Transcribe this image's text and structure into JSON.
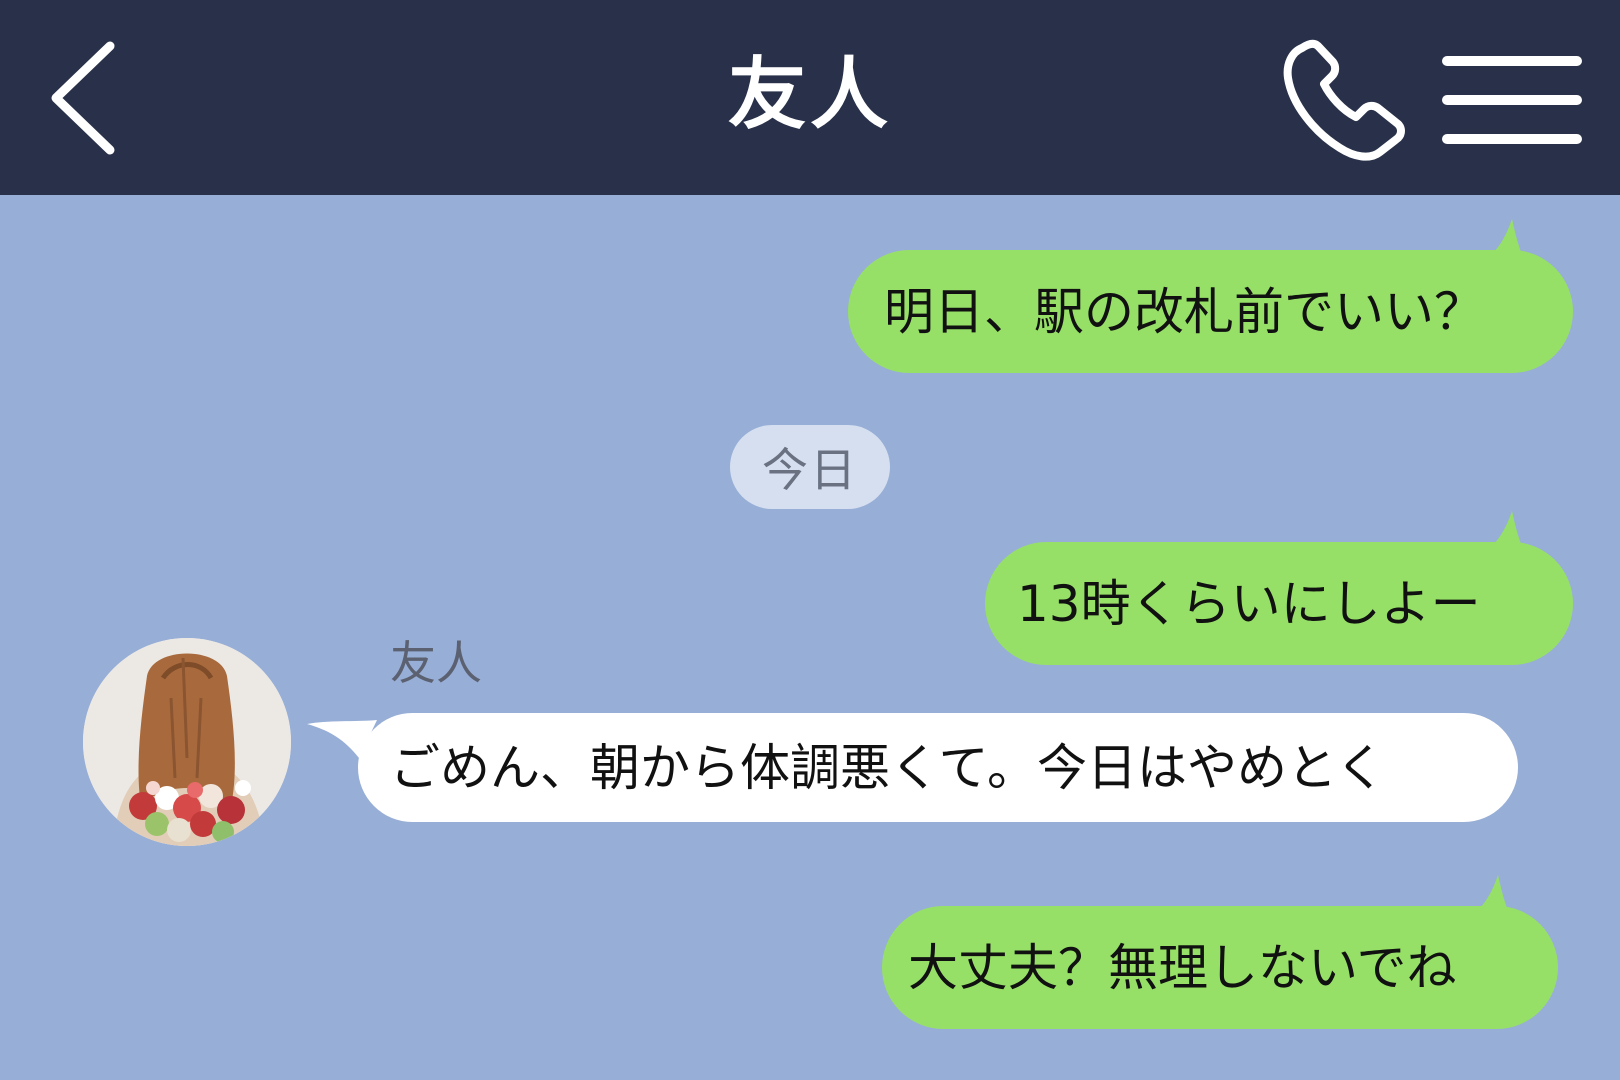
{
  "header": {
    "title": "友人",
    "back_icon": "chevron-left-icon",
    "call_icon": "phone-icon",
    "menu_icon": "hamburger-menu-icon"
  },
  "messages": [
    {
      "direction": "outgoing",
      "text": "明日、駅の改札前でいい？"
    },
    {
      "direction": "outgoing",
      "text": "13時くらいにしよー"
    },
    {
      "direction": "incoming",
      "sender": "友人",
      "text": "ごめん、朝から体調悪くて。今日はやめとく"
    },
    {
      "direction": "outgoing",
      "text": "大丈夫？無理しないでね"
    }
  ],
  "date_separator": "今日",
  "colors": {
    "header_bg": "#283149",
    "chat_bg": "#97aed6",
    "outgoing_bubble": "#97e067",
    "incoming_bubble": "#ffffff",
    "date_chip_bg": "#d5dff0"
  }
}
